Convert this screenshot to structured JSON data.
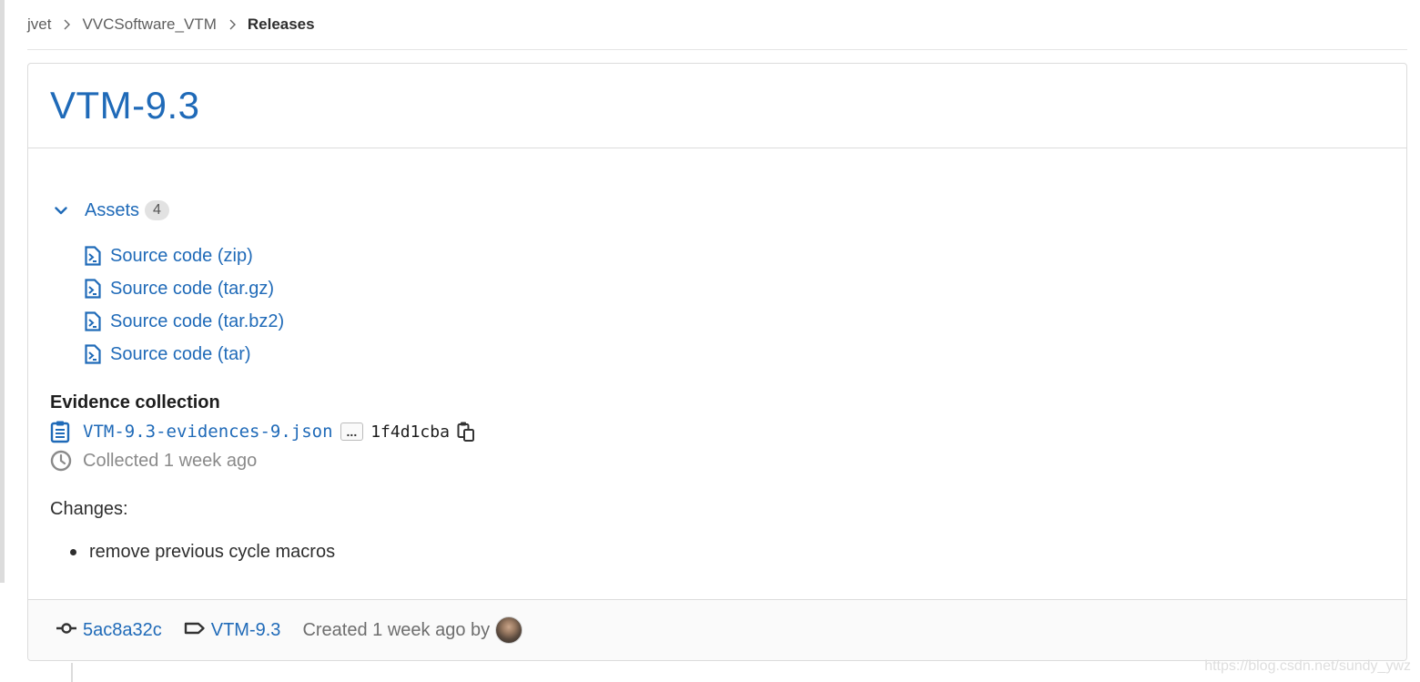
{
  "breadcrumb": {
    "items": [
      "jvet",
      "VVCSoftware_VTM",
      "Releases"
    ]
  },
  "release": {
    "title": "VTM-9.3"
  },
  "assets": {
    "label": "Assets",
    "count": "4",
    "items": [
      {
        "label": "Source code (zip)",
        "icon": "file-zip-icon"
      },
      {
        "label": "Source code (tar.gz)",
        "icon": "file-zip-icon"
      },
      {
        "label": "Source code (tar.bz2)",
        "icon": "file-zip-icon"
      },
      {
        "label": "Source code (tar)",
        "icon": "file-zip-icon"
      }
    ]
  },
  "evidence": {
    "title": "Evidence collection",
    "file": "VTM-9.3-evidences-9.json",
    "ellipsis": "...",
    "sha": "1f4d1cba",
    "collected": "Collected 1 week ago"
  },
  "changes": {
    "heading": "Changes:",
    "items": [
      "remove previous cycle macros"
    ]
  },
  "footer": {
    "commit": "5ac8a32c",
    "tag": "VTM-9.3",
    "created": "Created 1 week ago by"
  },
  "watermark": "https://blog.csdn.net/sundy_ywz",
  "colors": {
    "link": "#1f6ab8",
    "muted": "#8a8a8a",
    "border": "#dcdcdc"
  }
}
